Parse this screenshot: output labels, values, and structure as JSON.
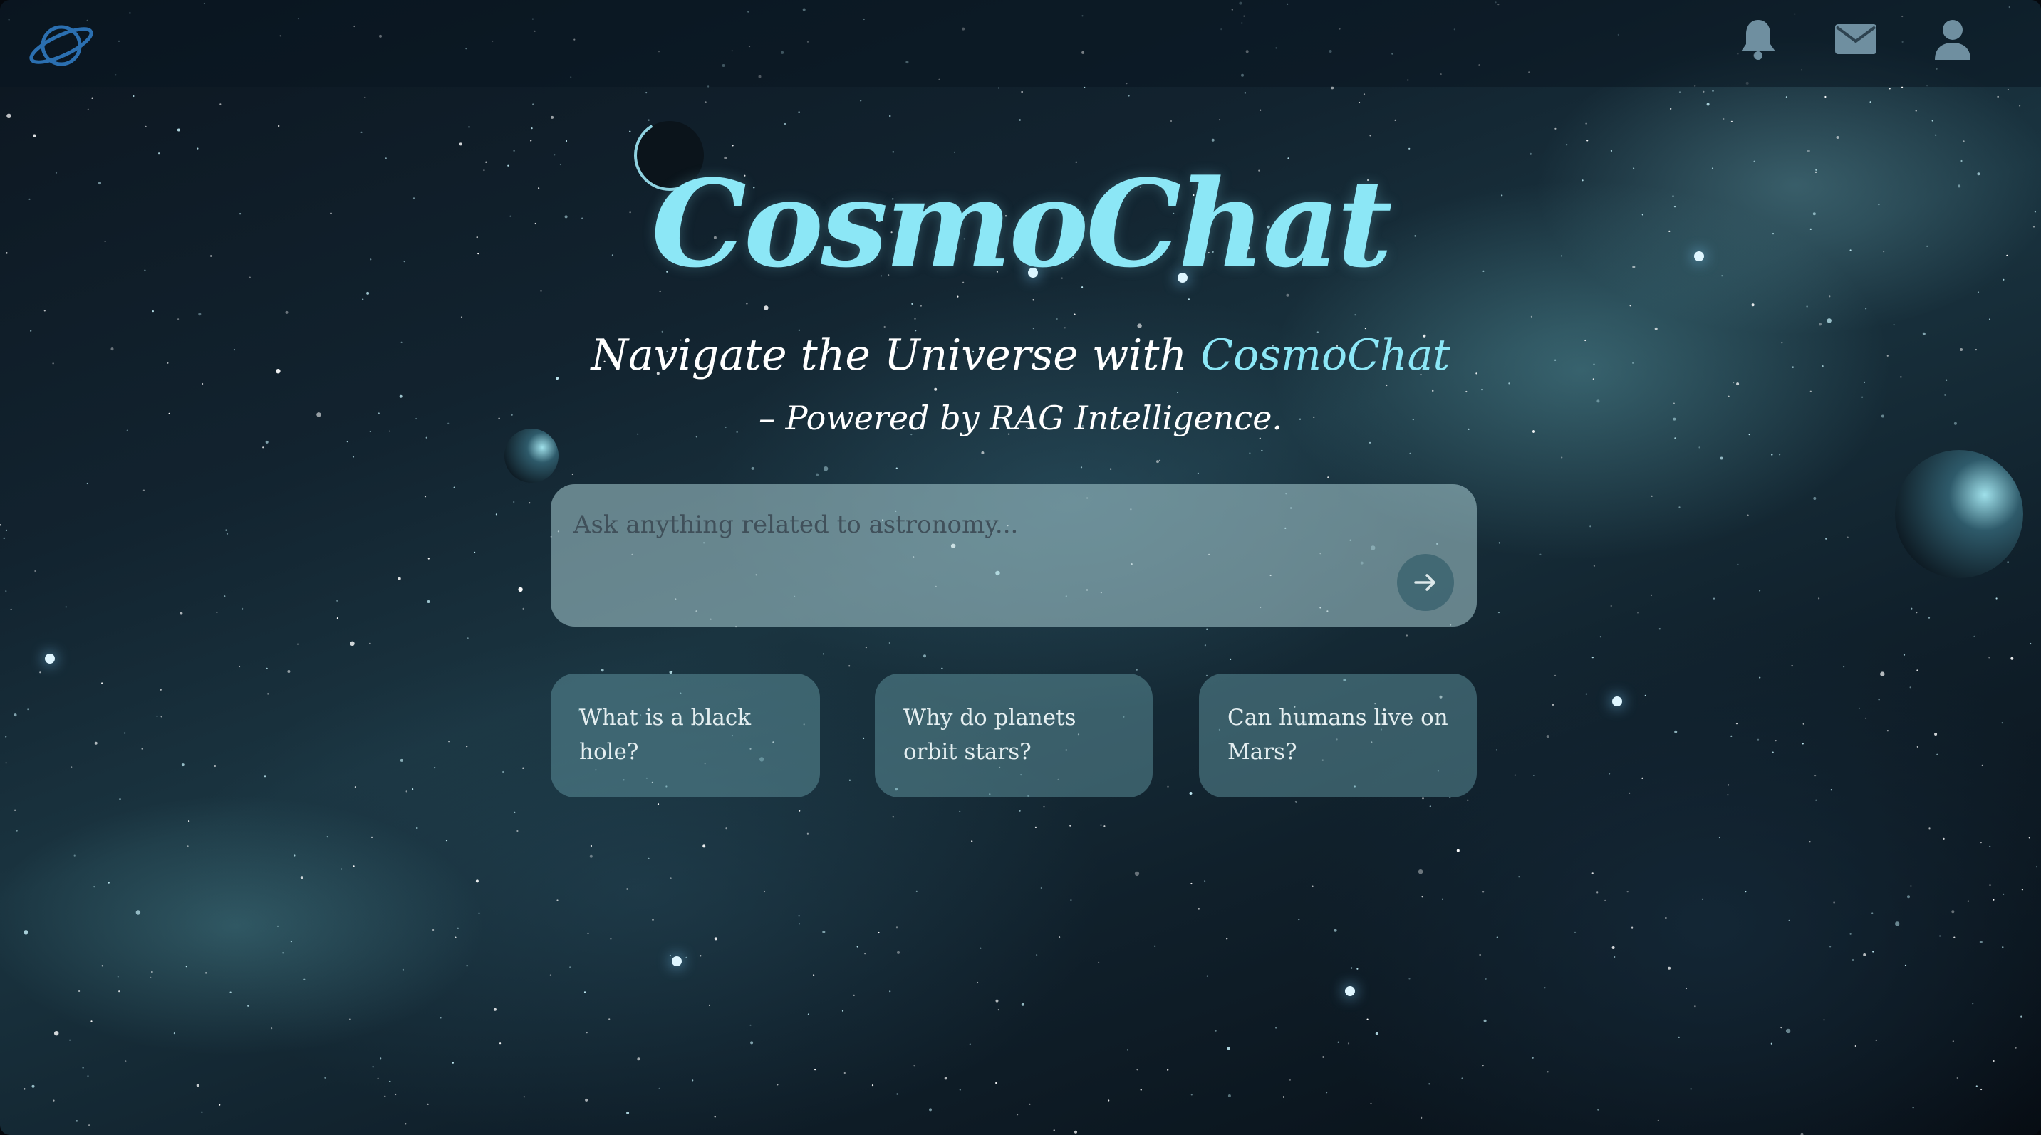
{
  "header": {
    "logo_icon": "saturn-planet-icon",
    "icons": [
      "bell-icon",
      "mail-icon",
      "user-icon"
    ]
  },
  "hero": {
    "title": "CosmoChat",
    "tagline_prefix": "Navigate the Universe with ",
    "tagline_brand": "CosmoChat",
    "tagline_line2": "– Powered by RAG Intelligence."
  },
  "search": {
    "placeholder": "Ask anything related to astronomy...",
    "value": "",
    "send_icon": "arrow-right-icon"
  },
  "suggestions": [
    "What is a black hole?",
    "Why do planets orbit stars?",
    "Can humans live on Mars?"
  ],
  "colors": {
    "accent": "#8ce7f6",
    "header_icon": "#6f8fa0",
    "logo": "#2b6fb0"
  }
}
